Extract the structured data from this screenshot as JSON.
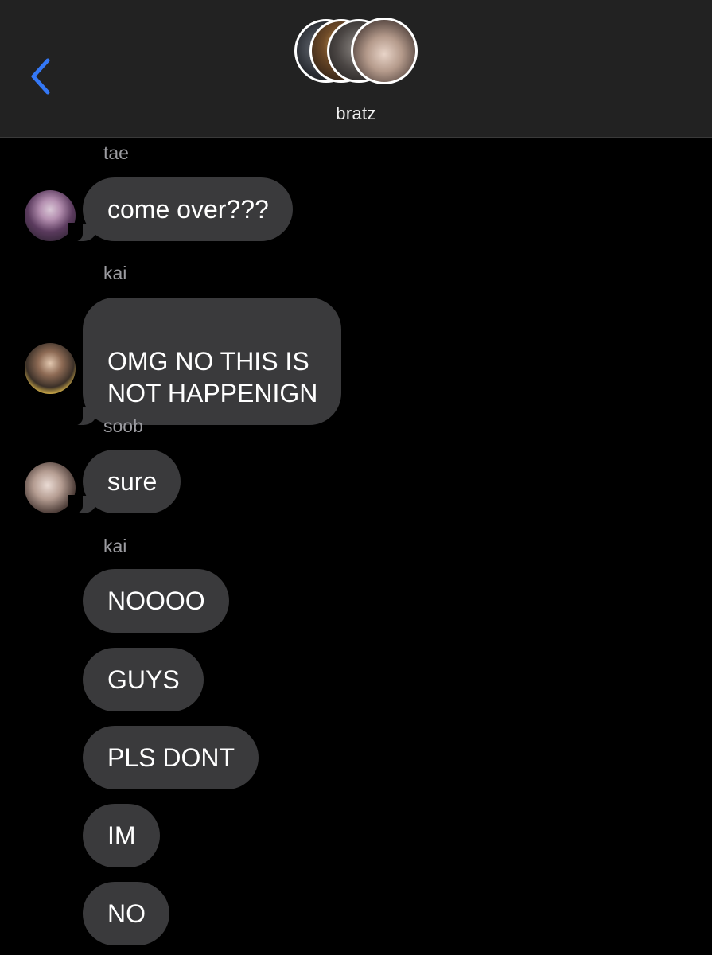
{
  "header": {
    "back_icon": "chevron-left-icon",
    "group_name": "bratz",
    "accent_color": "#3478f6"
  },
  "messages": [
    {
      "sender": "tae",
      "avatar": "avatar-tae",
      "texts": [
        "come over???"
      ]
    },
    {
      "sender": "kai",
      "avatar": "avatar-kai",
      "texts": [
        "OMG NO THIS IS\nNOT HAPPENIGN"
      ]
    },
    {
      "sender": "soob",
      "avatar": "avatar-soob",
      "texts": [
        "sure"
      ]
    },
    {
      "sender": "kai",
      "avatar": null,
      "texts": [
        "NOOOO",
        "GUYS",
        "PLS DONT",
        "IM",
        "NO"
      ]
    }
  ],
  "bubble_color": "#3a3a3c"
}
